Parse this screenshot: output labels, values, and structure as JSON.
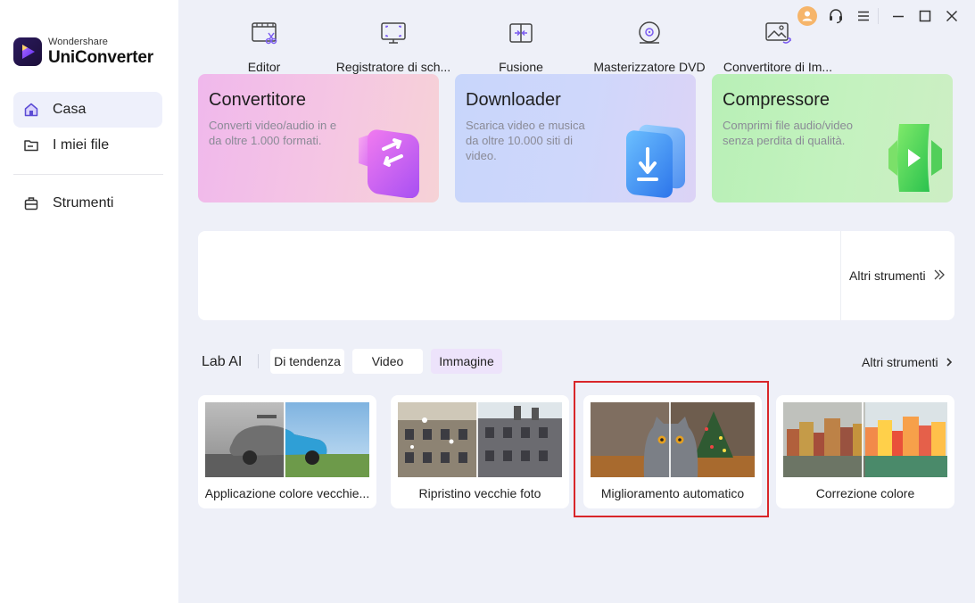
{
  "app": {
    "brand_small": "Wondershare",
    "brand_name": "UniConverter"
  },
  "sidebar": {
    "items": [
      {
        "label": "Casa",
        "icon": "home-icon",
        "active": true
      },
      {
        "label": "I miei file",
        "icon": "folder-icon",
        "active": false
      },
      {
        "label": "Strumenti",
        "icon": "toolbox-icon",
        "active": false
      }
    ]
  },
  "titlebar": {
    "icons": [
      "avatar-icon",
      "headset-icon",
      "menu-icon",
      "minimize-icon",
      "maximize-icon",
      "close-icon"
    ]
  },
  "hero_cards": [
    {
      "title": "Convertitore",
      "desc": "Converti video/audio in e da oltre 1.000 formati.",
      "icon": "convert-icon"
    },
    {
      "title": "Downloader",
      "desc": "Scarica video e musica da oltre 10.000 siti di video.",
      "icon": "download-icon"
    },
    {
      "title": "Compressore",
      "desc": "Comprimi file audio/video senza perdita di qualità.",
      "icon": "compress-icon"
    }
  ],
  "tools": {
    "items": [
      {
        "label": "Editor",
        "icon": "editor-icon"
      },
      {
        "label": "Registratore di sch...",
        "icon": "screen-recorder-icon"
      },
      {
        "label": "Fusione",
        "icon": "merge-icon"
      },
      {
        "label": "Masterizzatore DVD",
        "icon": "dvd-icon"
      },
      {
        "label": "Convertitore di Im...",
        "icon": "image-convert-icon"
      }
    ],
    "more_label": "Altri strumenti"
  },
  "lab": {
    "title": "Lab AI",
    "tabs": [
      {
        "label": "Di tendenza",
        "active": false
      },
      {
        "label": "Video",
        "active": false
      },
      {
        "label": "Immagine",
        "active": true
      }
    ],
    "more_label": "Altri strumenti",
    "cards": [
      {
        "label": "Applicazione colore vecchie..."
      },
      {
        "label": "Ripristino vecchie foto"
      },
      {
        "label": "Miglioramento automatico",
        "highlighted": true
      },
      {
        "label": "Correzione colore"
      }
    ]
  },
  "colors": {
    "accent": "#6a3df0",
    "highlight_border": "#d9262a",
    "active_chip": "#ede3fb",
    "background": "#eef0f8"
  }
}
